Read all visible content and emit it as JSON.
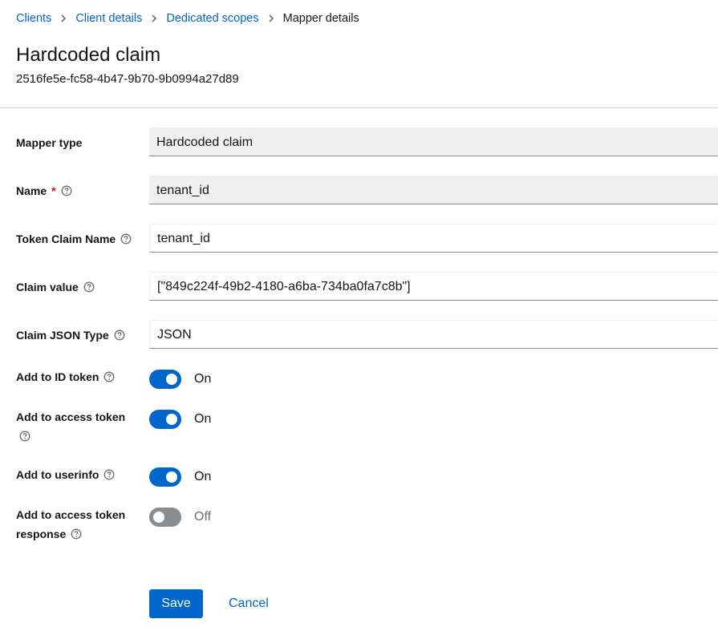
{
  "breadcrumb": {
    "items": [
      {
        "label": "Clients"
      },
      {
        "label": "Client details"
      },
      {
        "label": "Dedicated scopes"
      },
      {
        "label": "Mapper details"
      }
    ]
  },
  "header": {
    "title": "Hardcoded claim",
    "id": "2516fe5e-fc58-4b47-9b70-9b0994a27d89"
  },
  "form": {
    "mapper_type": {
      "label": "Mapper type",
      "value": "Hardcoded claim"
    },
    "name": {
      "label": "Name",
      "required_mark": "*",
      "value": "tenant_id"
    },
    "token_claim_name": {
      "label": "Token Claim Name",
      "value": "tenant_id"
    },
    "claim_value": {
      "label": "Claim value",
      "value": "[\"849c224f-49b2-4180-a6ba-734ba0fa7c8b\"]"
    },
    "claim_json_type": {
      "label": "Claim JSON Type",
      "value": "JSON"
    },
    "add_to_id_token": {
      "label": "Add to ID token",
      "state": "On",
      "checked": true
    },
    "add_to_access_token": {
      "label_line1": "Add to access token",
      "state": "On",
      "checked": true
    },
    "add_to_userinfo": {
      "label": "Add to userinfo",
      "state": "On",
      "checked": true
    },
    "add_to_access_token_response": {
      "label_line1": "Add to access token",
      "label_line2": "response",
      "state": "Off",
      "checked": false
    }
  },
  "actions": {
    "save_label": "Save",
    "cancel_label": "Cancel"
  },
  "colors": {
    "primary": "#0066cc",
    "toggle_off": "#8a8d90",
    "required": "#c9190b"
  },
  "icons": {
    "breadcrumb_separator": "chevron-right-icon",
    "help": "help-icon"
  }
}
